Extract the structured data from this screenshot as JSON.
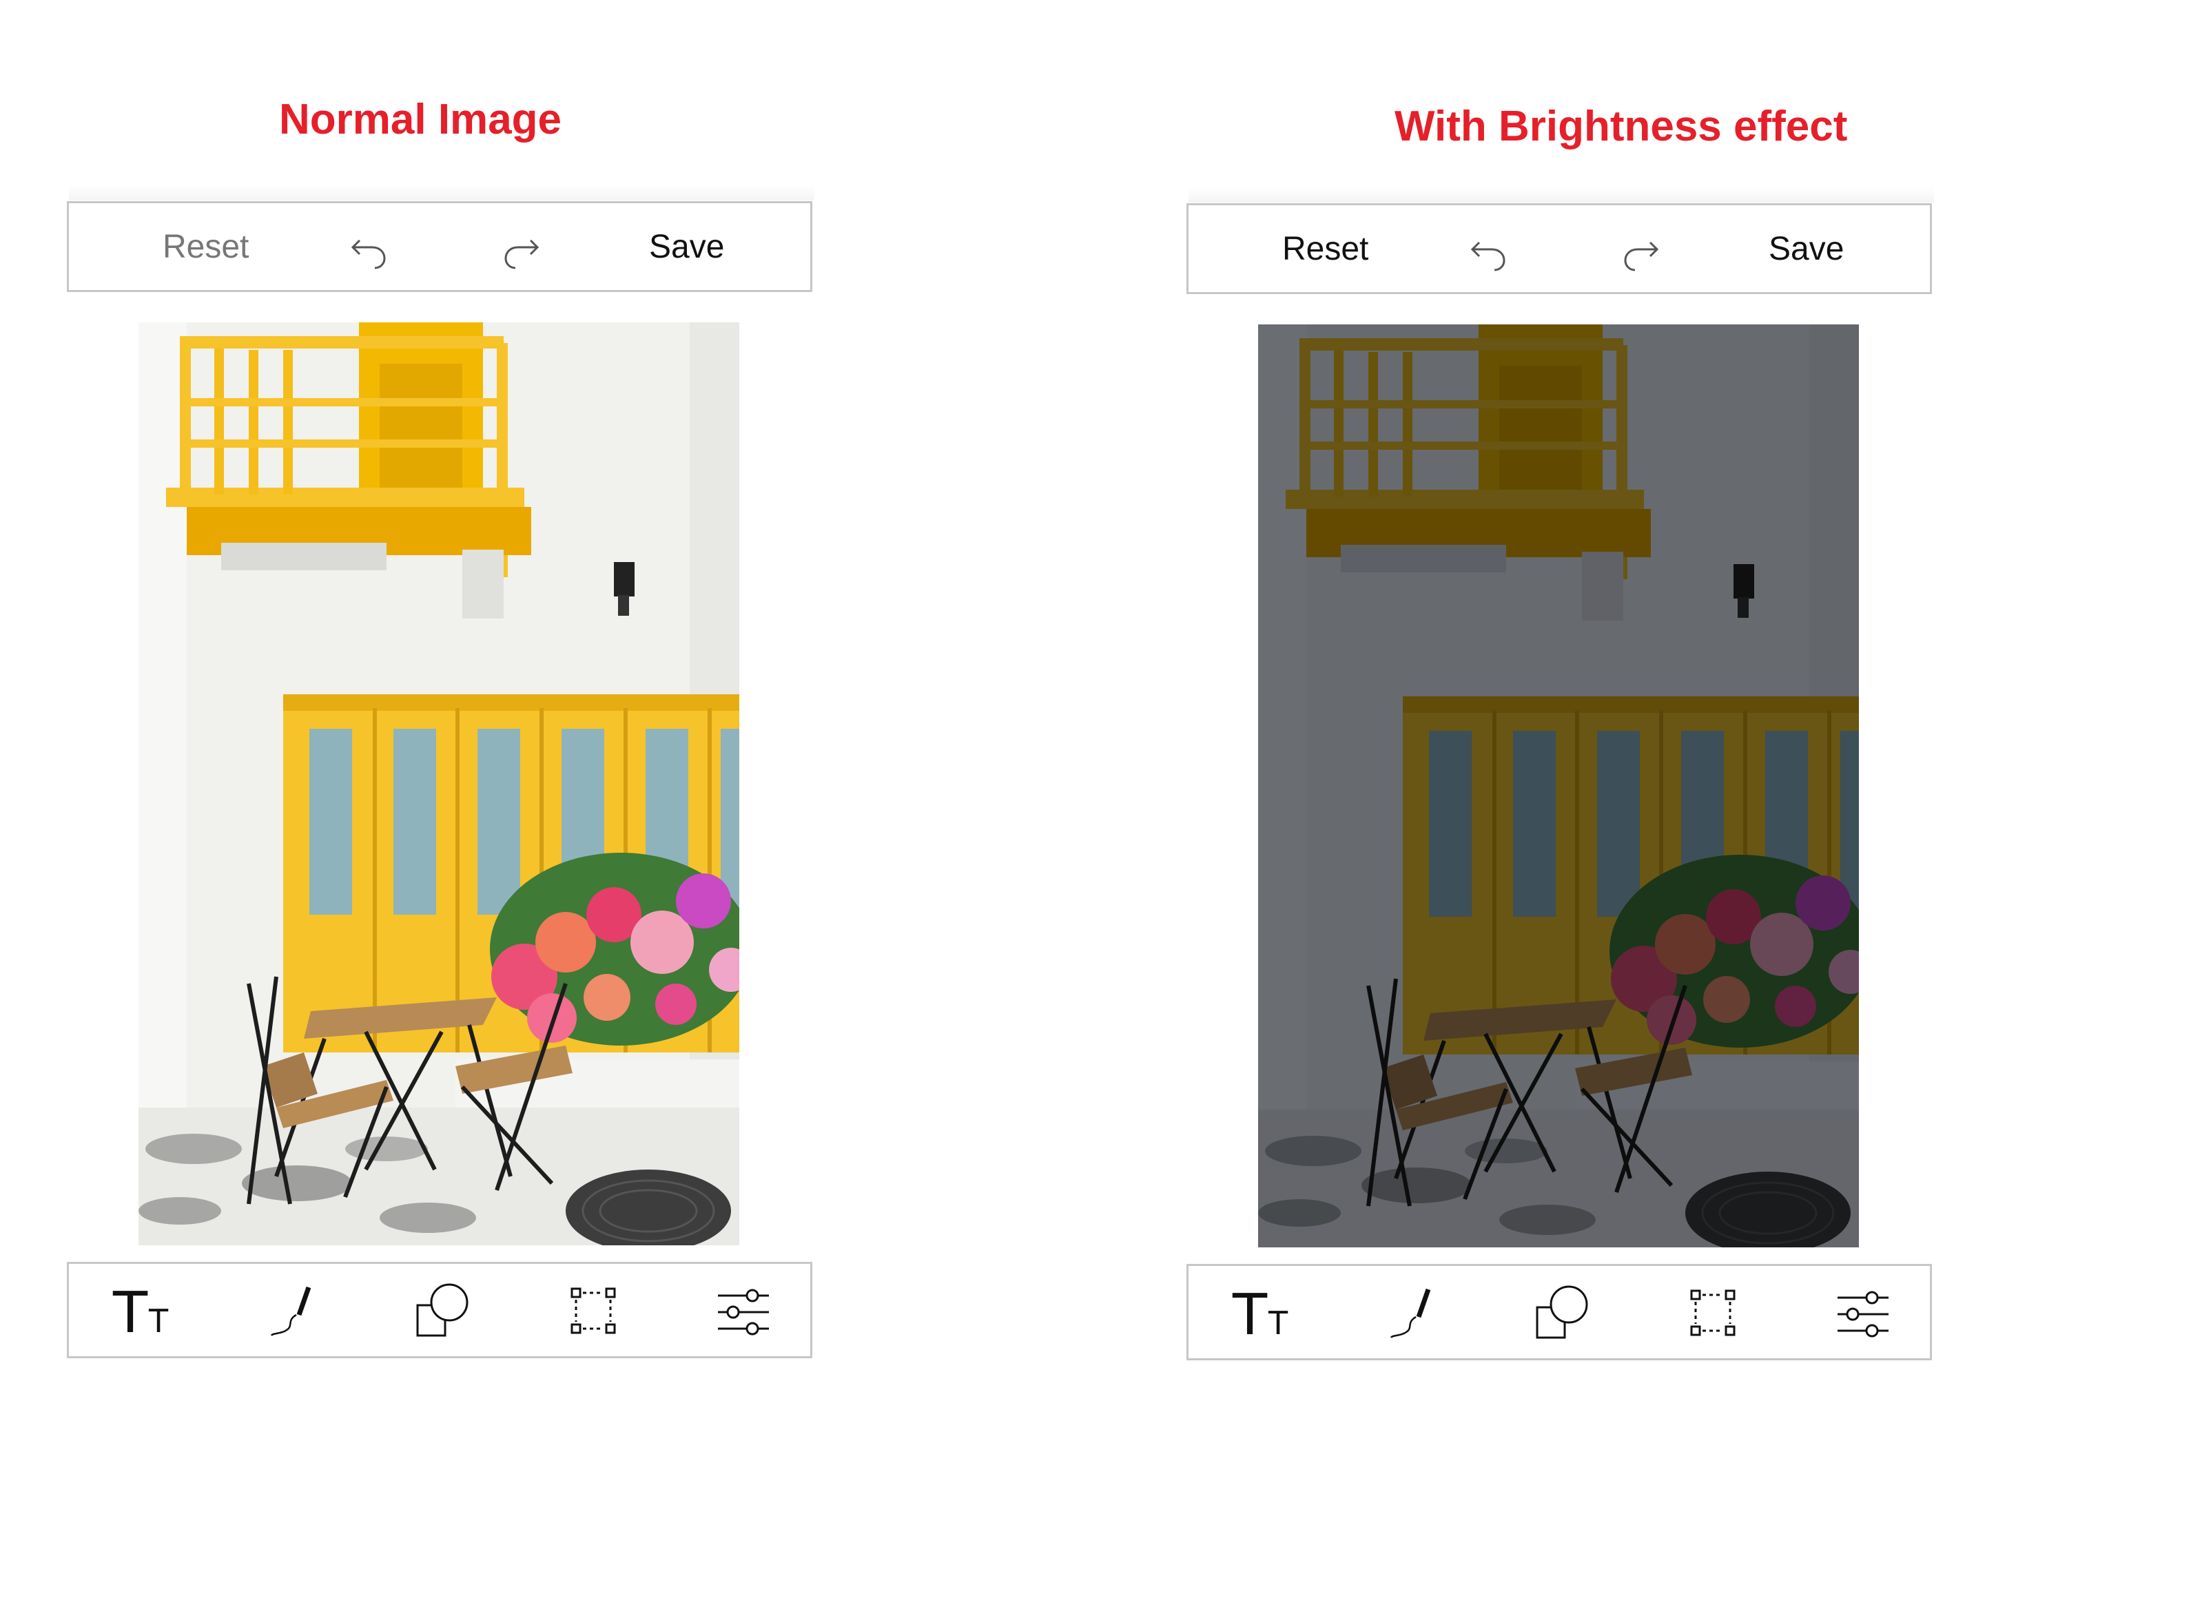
{
  "captions": {
    "left": "Normal Image",
    "right": "With Brightness effect"
  },
  "colors": {
    "caption": "#e5202a",
    "yellow": "#f6c32a",
    "wall": "#f1f1ee"
  },
  "panels": [
    {
      "toolbar": {
        "reset_label": "Reset",
        "reset_enabled": false,
        "undo_icon": "undo-icon",
        "redo_icon": "redo-icon",
        "save_label": "Save"
      },
      "bottom_toolbar": {
        "text_tool_glyph_big": "T",
        "text_tool_glyph_small": "T",
        "tools": [
          "text-tool-icon",
          "draw-pen-icon",
          "shapes-icon",
          "crop-icon",
          "adjust-sliders-icon"
        ]
      }
    },
    {
      "toolbar": {
        "reset_label": "Reset",
        "reset_enabled": true,
        "undo_icon": "undo-icon",
        "redo_icon": "redo-icon",
        "save_label": "Save"
      },
      "bottom_toolbar": {
        "text_tool_glyph_big": "T",
        "text_tool_glyph_small": "T",
        "tools": [
          "text-tool-icon",
          "draw-pen-icon",
          "shapes-icon",
          "crop-icon",
          "adjust-sliders-icon"
        ]
      }
    }
  ]
}
